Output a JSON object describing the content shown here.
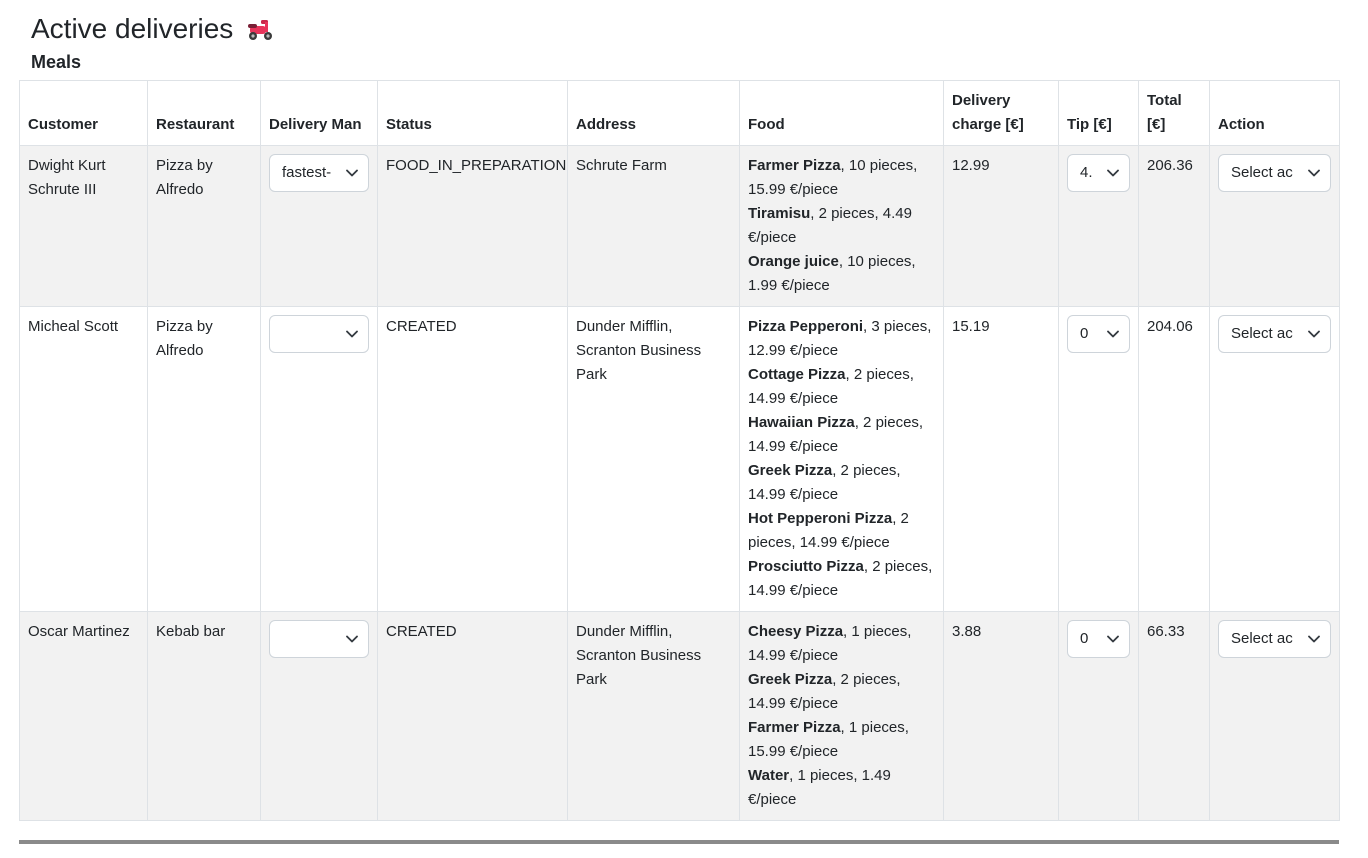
{
  "header": {
    "title": "Active deliveries",
    "icon": "scooter-icon",
    "subtitle": "Meals"
  },
  "table": {
    "headers": {
      "customer": "Customer",
      "restaurant": "Restaurant",
      "delivery_man": "Delivery Man",
      "status": "Status",
      "address": "Address",
      "food": "Food",
      "delivery_charge": "Delivery charge [€]",
      "tip": "Tip [€]",
      "total": "Total [€]",
      "action": "Action"
    },
    "rows": [
      {
        "customer": "Dwight Kurt Schrute III",
        "restaurant": "Pizza by Alfredo",
        "delivery_man": "fastest-",
        "status": "FOOD_IN_PREPARATION",
        "address": "Schrute Farm",
        "food": [
          {
            "name": "Farmer Pizza",
            "detail": ", 10 pieces, 15.99 €/piece"
          },
          {
            "name": "Tiramisu",
            "detail": ", 2 pieces, 4.49 €/piece"
          },
          {
            "name": "Orange juice",
            "detail": ", 10 pieces, 1.99 €/piece"
          }
        ],
        "delivery_charge": "12.99",
        "tip": "4.",
        "total": "206.36",
        "action": "Select ac"
      },
      {
        "customer": "Micheal Scott",
        "restaurant": "Pizza by Alfredo",
        "delivery_man": "",
        "status": "CREATED",
        "address": "Dunder Mifflin, Scranton Business Park",
        "food": [
          {
            "name": "Pizza Pepperoni",
            "detail": ", 3 pieces, 12.99 €/piece"
          },
          {
            "name": "Cottage Pizza",
            "detail": ", 2 pieces, 14.99 €/piece"
          },
          {
            "name": "Hawaiian Pizza",
            "detail": ", 2 pieces, 14.99 €/piece"
          },
          {
            "name": "Greek Pizza",
            "detail": ", 2 pieces, 14.99 €/piece"
          },
          {
            "name": "Hot Pepperoni Pizza",
            "detail": ", 2 pieces, 14.99 €/piece"
          },
          {
            "name": "Prosciutto Pizza",
            "detail": ", 2 pieces, 14.99 €/piece"
          }
        ],
        "delivery_charge": "15.19",
        "tip": "0",
        "total": "204.06",
        "action": "Select ac"
      },
      {
        "customer": "Oscar Martinez",
        "restaurant": "Kebab bar",
        "delivery_man": "",
        "status": "CREATED",
        "address": "Dunder Mifflin, Scranton Business Park",
        "food": [
          {
            "name": "Cheesy Pizza",
            "detail": ", 1 pieces, 14.99 €/piece"
          },
          {
            "name": "Greek Pizza",
            "detail": ", 2 pieces, 14.99 €/piece"
          },
          {
            "name": "Farmer Pizza",
            "detail": ", 1 pieces, 15.99 €/piece"
          },
          {
            "name": "Water",
            "detail": ", 1 pieces, 1.49 €/piece"
          }
        ],
        "delivery_charge": "3.88",
        "tip": "0",
        "total": "66.33",
        "action": "Select ac"
      }
    ]
  },
  "colors": {
    "stripe": "#f2f2f2",
    "border": "#dee2e6",
    "scooter": "#e8345a"
  }
}
